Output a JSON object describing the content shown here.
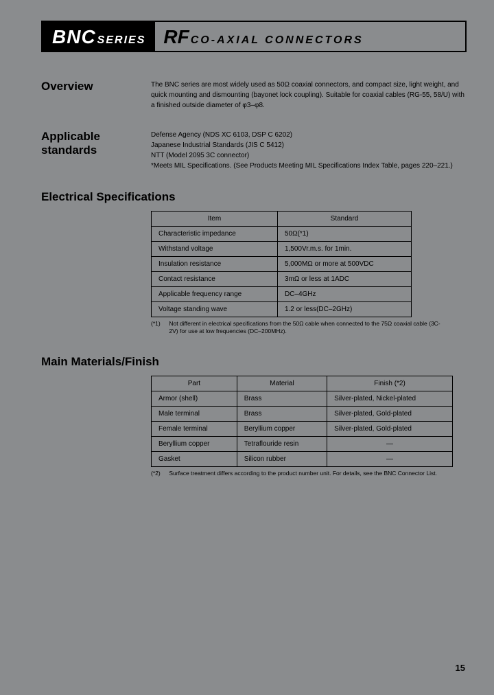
{
  "title": {
    "left_big": "BNC",
    "left_small": "SERIES",
    "right_big": "RF",
    "right_small": "CO-AXIAL CONNECTORS"
  },
  "overview": {
    "heading": "Overview",
    "body": "The BNC series are most widely used as 50Ω coaxial connectors, and compact size, light weight, and quick mounting and dismounting (bayonet lock coupling). Suitable for coaxial cables (RG-55, 58/U) with a finished outside diameter of φ3–φ8."
  },
  "standards": {
    "heading": "Applicable standards",
    "lines": [
      "Defense Agency (NDS XC 6103, DSP C 6202)",
      "Japanese Industrial Standards (JIS C 5412)",
      "NTT (Model 2095 3C connector)",
      "*Meets MIL Specifications. (See Products Meeting MIL Specifications Index Table, pages 220–221.)"
    ]
  },
  "elec": {
    "heading": "Electrical Specifications",
    "headers": [
      "Item",
      "Standard"
    ],
    "rows": [
      [
        "Characteristic impedance",
        "50Ω(*1)"
      ],
      [
        "Withstand voltage",
        "1,500Vr.m.s. for 1min."
      ],
      [
        "Insulation resistance",
        "5,000MΩ or more at 500VDC"
      ],
      [
        "Contact resistance",
        "3mΩ or less at 1ADC"
      ],
      [
        "Applicable frequency range",
        "DC–4GHz"
      ],
      [
        "Voltage standing wave",
        "1.2 or less(DC–2GHz)"
      ]
    ],
    "footnote_label": "(*1)",
    "footnote": "Not different in electrical specifications from the 50Ω cable when connected to the 75Ω coaxial cable (3C-2V) for use at low frequencies (DC–200MHz)."
  },
  "materials": {
    "heading": "Main Materials/Finish",
    "headers": [
      "Part",
      "Material",
      "Finish (*2)"
    ],
    "rows": [
      [
        "Armor (shell)",
        "Brass",
        "Silver-plated, Nickel-plated"
      ],
      [
        "Male terminal",
        "Brass",
        "Silver-plated, Gold-plated"
      ],
      [
        "Female terminal",
        "Beryllium copper",
        "Silver-plated, Gold-plated"
      ],
      [
        "Beryllium copper",
        "Tetraflouride resin",
        "—"
      ],
      [
        "Gasket",
        "Silicon rubber",
        "—"
      ]
    ],
    "footnote_label": "(*2)",
    "footnote": "Surface treatment differs according to the product number unit. For details, see the BNC Connector List."
  },
  "page_number": "15"
}
